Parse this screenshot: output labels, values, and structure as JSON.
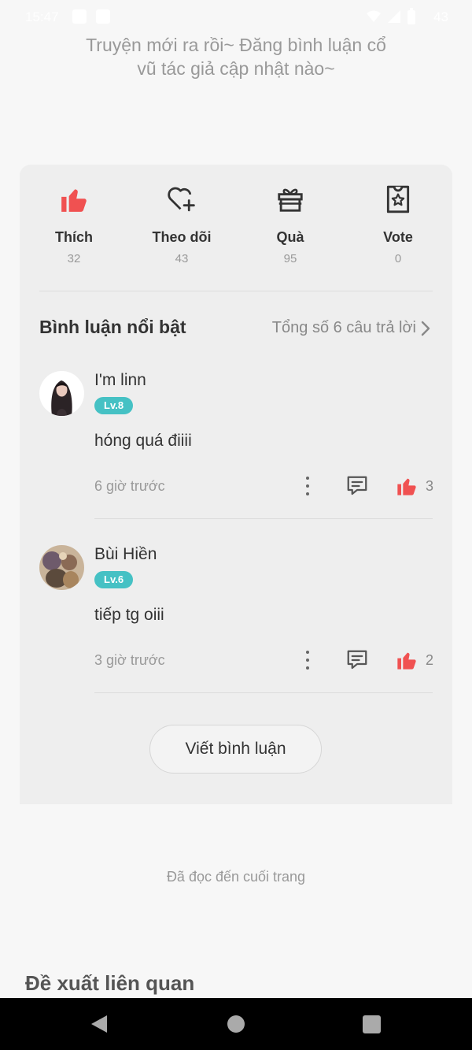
{
  "status_bar": {
    "time": "15:47",
    "battery": "43"
  },
  "intro": {
    "line1": "Truyện mới ra rồi~ Đăng bình luận cổ",
    "line2": "vũ tác giả cập nhật nào~"
  },
  "actions": [
    {
      "label": "Thích",
      "count": "32",
      "icon": "thumbs-up-icon"
    },
    {
      "label": "Theo dõi",
      "count": "43",
      "icon": "heart-plus-icon"
    },
    {
      "label": "Quà",
      "count": "95",
      "icon": "gift-icon"
    },
    {
      "label": "Vote",
      "count": "0",
      "icon": "vote-ticket-icon"
    }
  ],
  "comments_section": {
    "title": "Bình luận nổi bật",
    "total_label": "Tổng số 6 câu trả lời"
  },
  "comments": [
    {
      "username": "I'm linn",
      "level": "Lv.8",
      "text": "hóng quá điiii",
      "time": "6 giờ trước",
      "likes": "3"
    },
    {
      "username": "Bùi Hiền",
      "level": "Lv.6",
      "text": "tiếp tg oiii",
      "time": "3 giờ trước",
      "likes": "2"
    }
  ],
  "write_comment_label": "Viết bình luận",
  "end_label": "Đã đọc đến cuối trang",
  "related_title": "Đề xuất liên quan",
  "colors": {
    "accent_red": "#f05151",
    "level_badge": "#45c1c4",
    "card_bg": "#eeeeee"
  }
}
